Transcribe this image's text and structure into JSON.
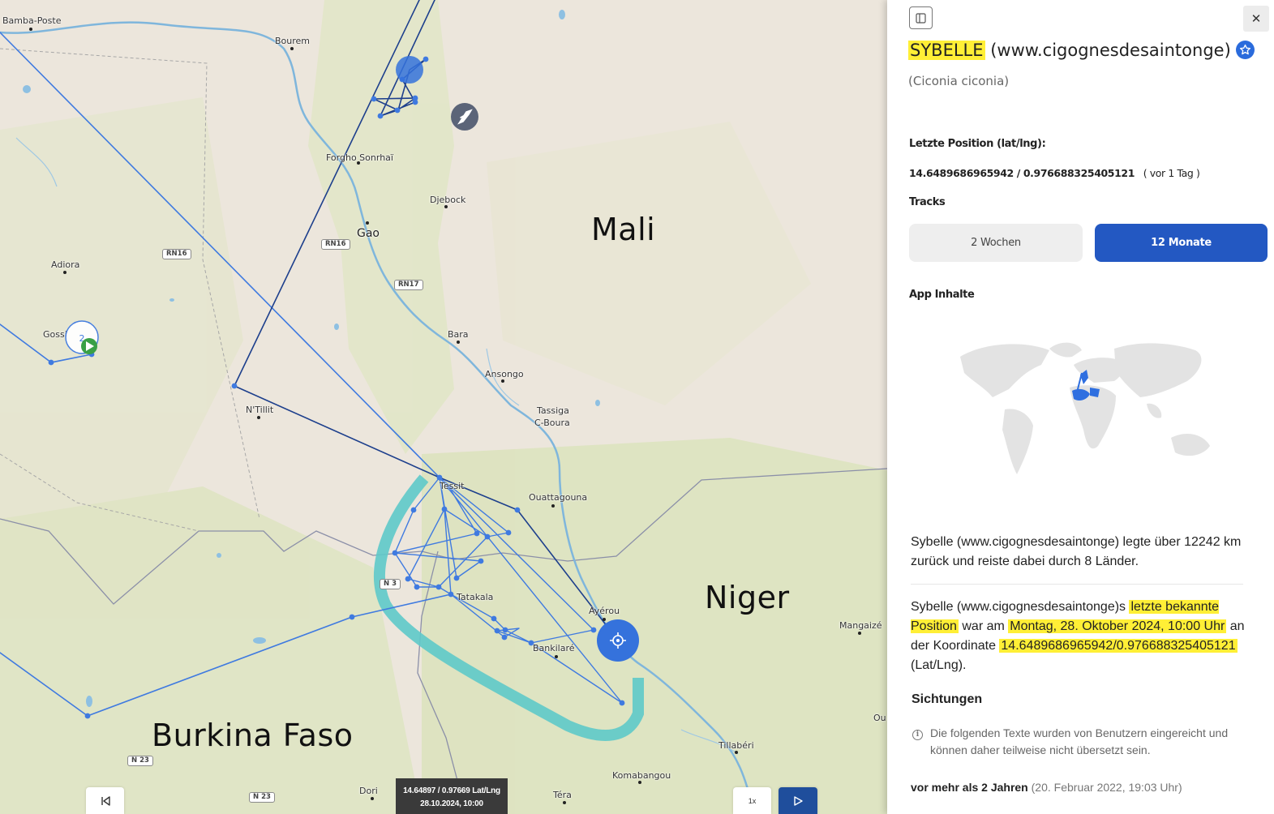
{
  "map": {
    "countries": [
      "Mali",
      "Niger",
      "Burkina Faso"
    ],
    "places": [
      {
        "name": "Bamba-Poste"
      },
      {
        "name": "Bourem"
      },
      {
        "name": "Forgho Sonrhaï"
      },
      {
        "name": "Djebock"
      },
      {
        "name": "Gao"
      },
      {
        "name": "Adiora"
      },
      {
        "name": "Gossi"
      },
      {
        "name": "Bara"
      },
      {
        "name": "Ansongo"
      },
      {
        "name": "Tassiga"
      },
      {
        "name": "C-Boura"
      },
      {
        "name": "N'Tillit"
      },
      {
        "name": "Tessit"
      },
      {
        "name": "Ouattagouna"
      },
      {
        "name": "Ayérou"
      },
      {
        "name": "Tatakala"
      },
      {
        "name": "Bankilaré"
      },
      {
        "name": "Mangaizé"
      },
      {
        "name": "Tillabéri"
      },
      {
        "name": "Komabangou"
      },
      {
        "name": "Dori"
      },
      {
        "name": "Téra"
      },
      {
        "name": "Ou"
      }
    ],
    "roads": [
      "RN16",
      "RN16",
      "RN17",
      "N 3",
      "N 23",
      "N 23"
    ],
    "cluster_count": "2",
    "colors": {
      "track_recent": "#1d3f8c",
      "track_old": "#3f7ae0",
      "forecast": "#5ec9c9",
      "marker": "#2f6fe0"
    },
    "icons": [
      "stork-icon",
      "play-icon",
      "target-icon"
    ],
    "coord_tooltip": {
      "line1": "14.64897 / 0.97669 Lat/Lng",
      "line2": "28.10.2024, 10:00"
    },
    "controls": {
      "speed": "1x"
    }
  },
  "panel": {
    "title_name": "SYBELLE",
    "title_rest": "(www.cigognesdesaintonge)",
    "species": "(Ciconia ciconia)",
    "position_label": "Letzte Position (lat/lng):",
    "position_value": "14.6489686965942 / 0.976688325405121",
    "position_age": "( vor 1 Tag )",
    "tracks_label": "Tracks",
    "tracks": [
      {
        "label": "2 Wochen",
        "active": false
      },
      {
        "label": "12 Monate",
        "active": true
      }
    ],
    "app_label": "App Inhalte",
    "summary": "Sybelle (www.cigognesdesaintonge) legte über 12242 km zurück und reiste dabei durch 8 Länder.",
    "lastpos": {
      "p1": "Sybelle (www.cigognesdesaintonge)s ",
      "h1": "letzte bekannte Position",
      "p2": " war am ",
      "h2": "Montag, 28. Oktober 2024, 10:00 Uhr",
      "p3": " an der Koordinate ",
      "h3": "14.6489686965942/0.976688325405121",
      "p4": " (Lat/Lng)."
    },
    "sightings_heading": "Sichtungen",
    "sightings_note": "Die folgenden Texte wurden von Benutzern eingereicht und können daher teilweise nicht übersetzt sein.",
    "sighting_ago": "vor mehr als 2 Jahren",
    "sighting_date": "(20. Februar 2022, 19:03 Uhr)",
    "colors": {
      "highlight": "#ffef36",
      "accent": "#2358c2"
    }
  }
}
